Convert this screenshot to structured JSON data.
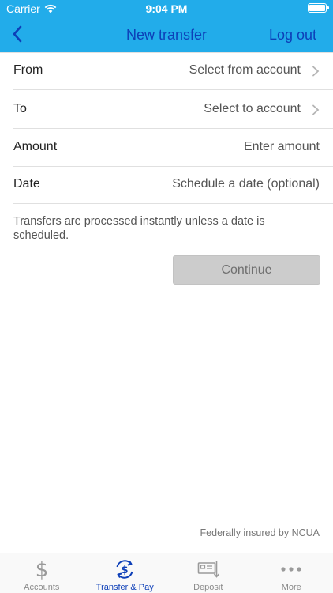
{
  "status_bar": {
    "carrier": "Carrier",
    "time": "9:04 PM"
  },
  "nav": {
    "title": "New transfer",
    "logout": "Log out"
  },
  "form": [
    {
      "label": "From",
      "value": "Select from account",
      "chevron": true
    },
    {
      "label": "To",
      "value": "Select to account",
      "chevron": true
    },
    {
      "label": "Amount",
      "value": "Enter amount",
      "chevron": false
    },
    {
      "label": "Date",
      "value": "Schedule a date (optional)",
      "chevron": false
    }
  ],
  "note": "Transfers are processed instantly unless a date is scheduled.",
  "continue_label": "Continue",
  "footnote": "Federally insured by NCUA",
  "tabs": [
    {
      "label": "Accounts",
      "icon": "dollar-icon",
      "active": false
    },
    {
      "label": "Transfer & Pay",
      "icon": "transfer-icon",
      "active": true
    },
    {
      "label": "Deposit",
      "icon": "deposit-check-icon",
      "active": false
    },
    {
      "label": "More",
      "icon": "ellipsis-icon",
      "active": false
    }
  ],
  "colors": {
    "header": "#22acea",
    "accent": "#0d3fb8",
    "button_disabled": "#cccccc"
  }
}
